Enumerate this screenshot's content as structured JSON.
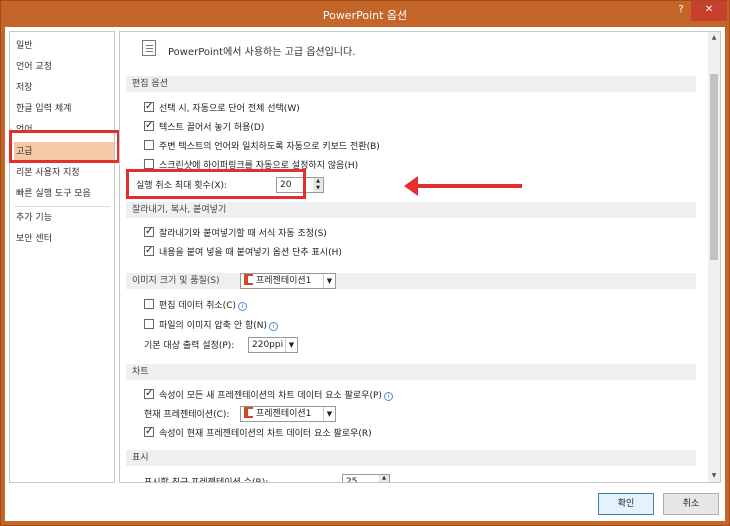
{
  "window": {
    "title": "PowerPoint 옵션",
    "help_label": "?",
    "close_label": "✕"
  },
  "sidebar": {
    "items": [
      {
        "label": "일반"
      },
      {
        "label": "언어 교정"
      },
      {
        "label": "저장"
      },
      {
        "label": "한글 입력 체계"
      },
      {
        "label": "언어"
      },
      {
        "label": "고급"
      },
      {
        "label": "리본 사용자 지정"
      },
      {
        "label": "빠른 실행 도구 모음"
      },
      {
        "label": "추가 기능"
      },
      {
        "label": "보안 센터"
      }
    ],
    "selected": "고급"
  },
  "main": {
    "header": "PowerPoint에서 사용하는 고급 옵션입니다.",
    "edit": {
      "title": "편집 옵션",
      "opt1": "선택 시, 자동으로 단어 전체 선택(W)",
      "opt2": "텍스트 끌어서 놓기 허용(D)",
      "opt3": "주변 텍스트의 언어와 일치하도록 자동으로 키보드 전환(B)",
      "opt4": "스크린샷에 하이퍼링크를 자동으로 설정하지 않음(H)",
      "undo_label": "실행 취소 최대 횟수(X):",
      "undo_value": "20"
    },
    "paste": {
      "title": "잘라내기, 복사, 붙여넣기",
      "opt1": "잘라내기와 붙여넣기할 때 서식 자동 조정(S)",
      "opt2": "내용을 붙여 넣을 때 붙여넣기 옵션 단추 표시(H)"
    },
    "image": {
      "title": "이미지 크기 및 품질(S)",
      "presentation": "프레젠테이션1",
      "opt1": "편집 데이터 취소(C)",
      "opt2": "파일의 이미지 압축 안 함(N)",
      "output_label": "기본 대상 출력 설정(P):",
      "output_value": "220ppi"
    },
    "chart": {
      "title": "차트",
      "opt1": "속성이 모든 새 프레젠테이션의 차트 데이터 요소 팔로우(P)",
      "current_label": "현재 프레젠테이션(C):",
      "current_value": "프레젠테이션1",
      "opt2": "속성이 현재 프레젠테이션의 차트 데이터 요소 팔로우(R)"
    },
    "display": {
      "title": "표시",
      "recent_label": "표시할 최근 프레젠테이션 수(R):",
      "recent_value": "25"
    }
  },
  "buttons": {
    "ok": "확인",
    "cancel": "취소"
  },
  "colors": {
    "frame": "#c4652a",
    "selected_nav": "#f6c8a4",
    "highlight": "#e03030"
  }
}
